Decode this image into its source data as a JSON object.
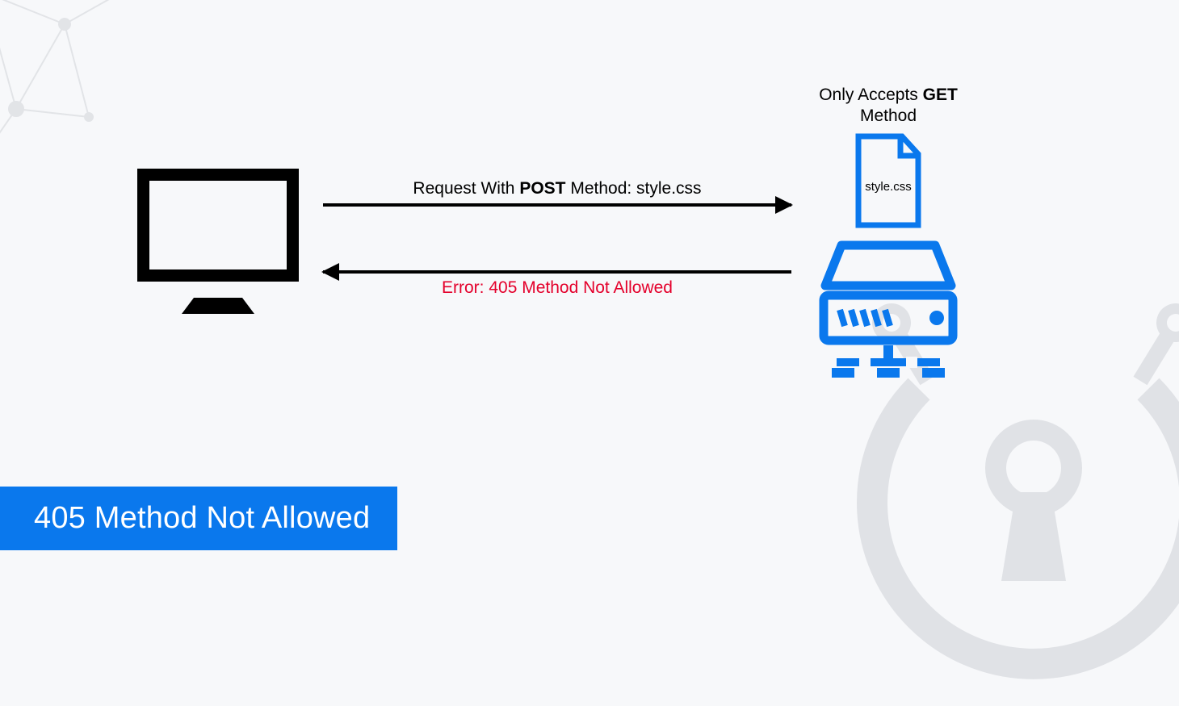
{
  "banner": {
    "title": "405 Method Not Allowed"
  },
  "diagram": {
    "request_label_pre": "Request With ",
    "request_method": "POST",
    "request_label_post": " Method: style.css",
    "response_label": "Error: 405 Method Not Allowed",
    "server_caption_pre": "Only Accepts ",
    "server_caption_bold": "GET",
    "server_caption_post": "Method",
    "file_label": "style.css"
  },
  "colors": {
    "accent_blue": "#0a78ed",
    "error_red": "#e4002b",
    "bg": "#f7f8fa",
    "decoration": "#e0e2e6"
  }
}
